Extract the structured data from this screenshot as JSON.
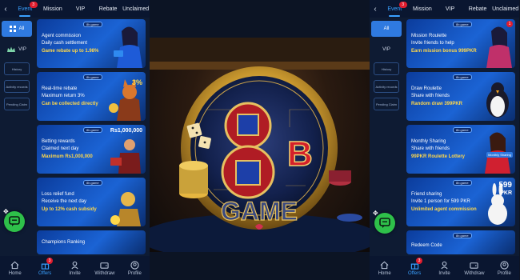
{
  "colors": {
    "accent": "#3aa0ff",
    "badge": "#e11d2e",
    "highlight": "#ffd84a",
    "chat": "#2ec04a"
  },
  "left": {
    "tabs": [
      {
        "label": "Event",
        "badge": "3"
      },
      {
        "label": "Mission"
      },
      {
        "label": "VIP"
      },
      {
        "label": "Rebate"
      },
      {
        "label": "Unclaimed"
      }
    ],
    "sidebar": {
      "all": "All",
      "vip": "VIP",
      "history": "History",
      "records": "Activity records",
      "pending": "Pending Claim"
    },
    "cards": [
      {
        "logo": "8b.game",
        "l1": "Agent commission",
        "l2": "Daily cash settlement",
        "l3": "Game rebate up to 1.98%",
        "badge": "",
        "art": "woman"
      },
      {
        "logo": "8b.game",
        "l1": "Real-time rebate",
        "l2": "Maximum return 3%",
        "l3": "Can be collected directly",
        "badge": "",
        "art": "fox"
      },
      {
        "logo": "8b.game",
        "l1": "Betting rewards",
        "l2": "Claimed next day",
        "l3": "Maximum Rs1,000,000",
        "badge": "",
        "art": "sword"
      },
      {
        "logo": "8b.game",
        "l1": "Loss relief fund",
        "l2": "Receive the next day",
        "l3": "Up to 12% cash subsidy",
        "badge": "",
        "art": "gold"
      },
      {
        "logo": "",
        "l1": "Champions Ranking",
        "l2": "",
        "l3": "",
        "badge": "",
        "art": ""
      }
    ],
    "art_text": {
      "percent": "3%",
      "amount": "Rs1,000,000"
    }
  },
  "right": {
    "tabs": [
      {
        "label": "Event",
        "badge": "3"
      },
      {
        "label": "Mission"
      },
      {
        "label": "VIP"
      },
      {
        "label": "Rebate"
      },
      {
        "label": "Unclaimed"
      }
    ],
    "sidebar": {
      "all": "All",
      "vip": "VIP",
      "history": "History",
      "records": "Activity records",
      "pending": "Pending Claim"
    },
    "cards": [
      {
        "logo": "8b.game",
        "l1": "Mission Roulette",
        "l2": "Invite friends to help",
        "l3": "Earn mission bonus 999PKR",
        "badge": "1",
        "art": "woman"
      },
      {
        "logo": "8b.game",
        "l1": "Draw Roulette",
        "l2": "Share with friends",
        "l3": "Random draw 399PKR",
        "badge": "",
        "art": "penguin"
      },
      {
        "logo": "8b.game",
        "l1": "Monthly Sharing",
        "l2": "Share with friends",
        "l3": "99PKR Roulette Lottery",
        "badge": "",
        "art": "woman2"
      },
      {
        "logo": "8b.game",
        "l1": "Friend sharing",
        "l2": "Invite 1 person for 599 PKR",
        "l3": "Unlimited agent commission",
        "badge": "",
        "art": "bunny"
      },
      {
        "logo": "8b.game",
        "l1": "Redeem Code",
        "l2": "",
        "l3": "",
        "badge": "",
        "art": ""
      }
    ],
    "art_text": {
      "price": "599",
      "unit": "PKR",
      "sharing": "Monthly Sharing"
    }
  },
  "nav": [
    {
      "label": "Home"
    },
    {
      "label": "Offers",
      "badge": "3"
    },
    {
      "label": "Invite"
    },
    {
      "label": "Withdraw"
    },
    {
      "label": "Profile"
    }
  ],
  "hero": {
    "brand_b": "B",
    "brand_8": "8",
    "word": "GAME"
  }
}
